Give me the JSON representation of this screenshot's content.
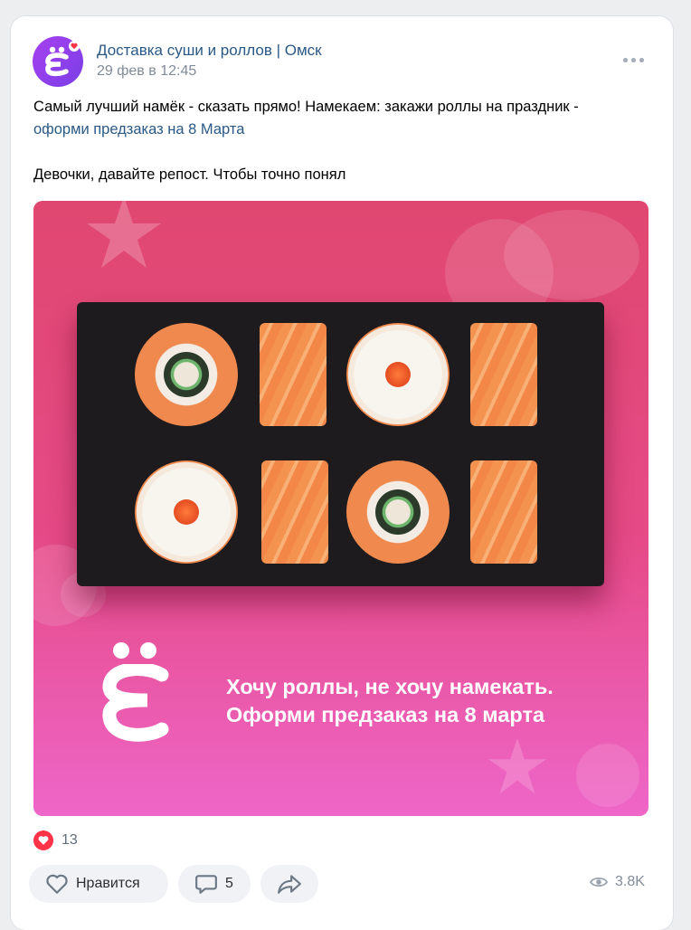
{
  "post": {
    "group_name": "Доставка суши и роллов | Омск",
    "date": "29 фев в 12:45",
    "text_line1": "Самый лучший намёк - сказать прямо! Намекаем: закажи роллы на праздник -",
    "text_link": "оформи предзаказ на 8 Марта",
    "text_line3": "Девочки, давайте репост. Чтобы точно понял"
  },
  "image": {
    "slogan_line1": "Хочу роллы, не хочу намекать.",
    "slogan_line2": "Оформи предзаказ на 8 марта",
    "colors": {
      "top": "#e04770",
      "bottom": "#ee66c8",
      "tray": "#1d1b1e",
      "salmon": "#f0894e"
    }
  },
  "reactions": {
    "icon": "heart-icon",
    "count": "13"
  },
  "actions": {
    "like_label": "Нравится",
    "comment_count": "5"
  },
  "views": {
    "icon": "eye-icon",
    "count": "3.8K"
  },
  "colors": {
    "accent_link": "#2a5885",
    "like_red": "#ff3347",
    "muted": "#818c99"
  }
}
